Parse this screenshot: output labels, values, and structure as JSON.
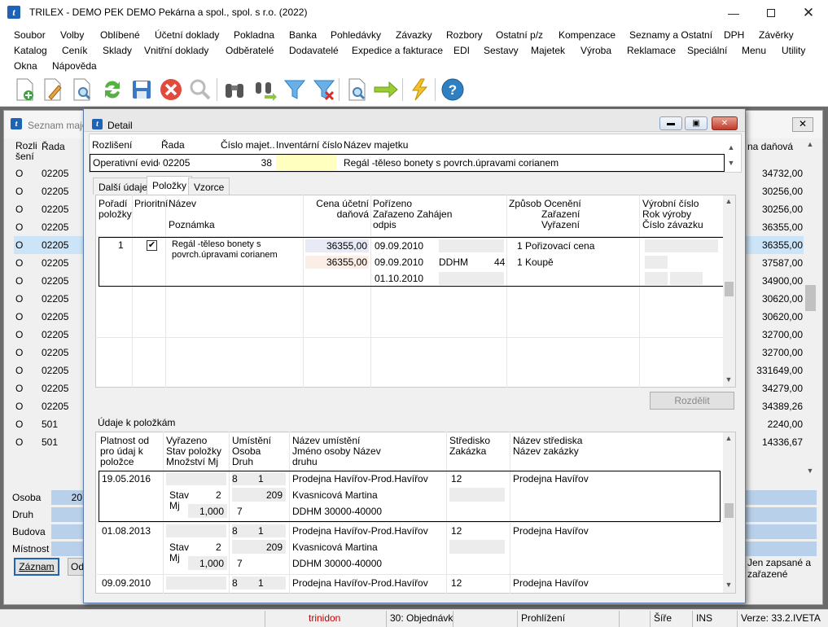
{
  "window": {
    "title": "TRILEX - DEMO PEK DEMO Pekárna a spol., spol. s r.o. (2022)",
    "logo": "t"
  },
  "menu": [
    "Soubor",
    "Volby",
    "Oblíbené",
    "Účetní doklady",
    "Pokladna",
    "Banka",
    "Pohledávky",
    "Závazky",
    "Rozbory",
    "Ostatní p/z",
    "Kompenzace",
    "Seznamy a Ostatní",
    "DPH",
    "Závěrky",
    "Katalog",
    "Ceník",
    "Sklady",
    "Vnitřní doklady",
    "Odběratelé",
    "Dodavatelé",
    "Expedice a fakturace",
    "EDI",
    "Sestavy",
    "Majetek",
    "Výroba",
    "Reklamace",
    "Speciální",
    "Menu",
    "Utility",
    "Okna",
    "Nápověda"
  ],
  "toolbar": [
    "new-doc-icon",
    "edit-doc-icon",
    "view-doc-icon",
    "refresh-icon",
    "save-icon",
    "delete-icon",
    "search-icon",
    "binoculars-icon",
    "binoculars-next-icon",
    "filter-icon",
    "filter-clear-icon",
    "print-preview-icon",
    "arrow-right-icon",
    "lightning-icon",
    "help-icon"
  ],
  "bg": {
    "title": "Seznam maje",
    "col1": "Rozli šení",
    "col2": "Řada",
    "col_right": "na daňová",
    "rows": [
      [
        "O",
        "02205",
        "34732,00"
      ],
      [
        "O",
        "02205",
        "30256,00"
      ],
      [
        "O",
        "02205",
        "30256,00"
      ],
      [
        "O",
        "02205",
        "36355,00"
      ],
      [
        "O",
        "02205",
        "36355,00"
      ],
      [
        "O",
        "02205",
        "37587,00"
      ],
      [
        "O",
        "02205",
        "34900,00"
      ],
      [
        "O",
        "02205",
        "30620,00"
      ],
      [
        "O",
        "02205",
        "30620,00"
      ],
      [
        "O",
        "02205",
        "32700,00"
      ],
      [
        "O",
        "02205",
        "32700,00"
      ],
      [
        "O",
        "02205",
        "331649,00"
      ],
      [
        "O",
        "02205",
        "34279,00"
      ],
      [
        "O",
        "02205",
        "34389,26"
      ],
      [
        "O",
        "501",
        "2240,00"
      ],
      [
        "O",
        "501",
        "14336,67"
      ]
    ],
    "bottom_labels": [
      "Osoba",
      "Druh",
      "Budova",
      "Místnost"
    ],
    "bottom_vals": [
      "20",
      "",
      "",
      "",
      ""
    ],
    "btn_zaznam": "Záznam",
    "btn_other": "Od",
    "note": "Jen zapsané a zařazené"
  },
  "detail": {
    "title": "Detail",
    "hdr": {
      "rozliseni": "Rozlišení",
      "rada": "Řada",
      "cislo": "Číslo majet...",
      "inventarni": "Inventární číslo",
      "nazev": "Název majetku"
    },
    "vals": {
      "rozliseni": "Operativní evide",
      "rada": "02205",
      "cislo": "38",
      "inventarni": "",
      "nazev": "Regál -těleso bonety s povrch.úpravami corianem"
    },
    "tabs": [
      "Další údaje",
      "Položky",
      "Vzorce"
    ],
    "grid1": {
      "h": {
        "poradi": "Pořadí položky",
        "prioritni": "Prioritní",
        "nazev": "Název",
        "poznamka": "Poznámka",
        "cena": "Cena účetní daňová",
        "porizeno": "Pořízeno Zařazeno Zahájen odpis",
        "zpusob": "Způsob Ocenění",
        "zarazeni": "Zařazení",
        "vyrazeni": "Vyřazení",
        "vyrobni": "Výrobní číslo Rok výroby Číslo závazku"
      },
      "row": {
        "poradi": "1",
        "nazev": "Regál -těleso bonety s povrch.úpravami corianem",
        "cena1": "36355,00",
        "cena2": "36355,00",
        "d1": "09.09.2010",
        "d2": "09.09.2010",
        "d3": "01.10.2010",
        "ddhm": "DDHM",
        "ddhmnum": "44",
        "z1": "1 Pořizovací cena",
        "z2": "1 Koupě"
      }
    },
    "btn_rozdelit": "Rozdělit",
    "sect": "Údaje k položkám",
    "grid2": {
      "h": {
        "platnost": "Platnost od pro údaj k položce",
        "vyrazeno": "Vyřazeno Stav položky Množství Mj",
        "umisteni": "Umístění Osoba Druh",
        "nazevum": "Název umístění Jméno osoby Název druhu",
        "stredisko": "Středisko Zakázka",
        "nazevst": "Název střediska Název zakázky"
      },
      "rows": [
        {
          "date": "19.05.2016",
          "stav": "Stav",
          "stavv": "2",
          "mj": "Mj",
          "qty": "1,000",
          "u1": "8",
          "u2": "1",
          "osoba": "209",
          "druh": "7",
          "n1": "Prodejna Havířov-Prod.Havířov",
          "n2": "Kvasnicová Martina",
          "n3": "DDHM 30000-40000",
          "st": "12",
          "ns": "Prodejna Havířov"
        },
        {
          "date": "01.08.2013",
          "stav": "Stav",
          "stavv": "2",
          "mj": "Mj",
          "qty": "1,000",
          "u1": "8",
          "u2": "1",
          "osoba": "209",
          "druh": "7",
          "n1": "Prodejna Havířov-Prod.Havířov",
          "n2": "Kvasnicová Martina",
          "n3": "DDHM 30000-40000",
          "st": "12",
          "ns": "Prodejna Havířov"
        },
        {
          "date": "09.09.2010",
          "u1": "8",
          "u2": "1",
          "n1": "Prodejna Havířov-Prod.Havířov",
          "st": "12",
          "ns": "Prodejna Havířov"
        }
      ]
    }
  },
  "status": {
    "user": "trinidon",
    "doc": "30: Objednávk",
    "mode": "Prohlížení",
    "sire": "Šíře",
    "ins": "INS",
    "ver": "Verze: 33.2.IVETA"
  },
  "colors": {
    "accent": "#1e63b6",
    "selection": "#cce4f7",
    "status_red": "#c00000"
  }
}
